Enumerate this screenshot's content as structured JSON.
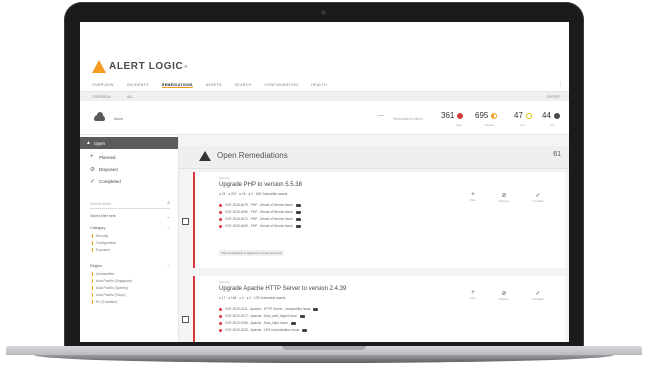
{
  "app": {
    "logo_text": "ALERT LOGIC",
    "logo_reg": "®",
    "nav": [
      "OVERVIEW",
      "INCIDENTS",
      "REMEDIATIONS",
      "ASSETS",
      "SEARCH",
      "CONFIGURATION",
      "HEALTH"
    ],
    "nav_active_index": 2,
    "menu_icon": "⋮",
    "subbar": {
      "crumb1": "OVERVIEW",
      "crumb2": "ALL",
      "right": "EXPORT"
    }
  },
  "stats": {
    "account": "Acme",
    "minus": "—",
    "range": "Remediations filters",
    "high": {
      "value": "361",
      "label": "High",
      "color": "#d63a3a"
    },
    "medium": {
      "value": "695",
      "label": "Medium",
      "color": "#f39c22"
    },
    "low": {
      "value": "47",
      "label": "Low",
      "color": "#d9c300"
    },
    "info": {
      "value": "44",
      "label": "Info",
      "color": "#4a4a4a"
    }
  },
  "sidebar": {
    "open_label": "Open",
    "items": [
      {
        "icon": "+",
        "label": "Planned"
      },
      {
        "icon": "⊘",
        "label": "Disposed"
      },
      {
        "icon": "✓",
        "label": "Completed"
      }
    ],
    "search_placeholder": "Search filters",
    "search_icon": "⌕",
    "sort_label": "Saved filter sets",
    "category": {
      "title": "Category",
      "options": [
        "Security",
        "Configuration",
        "Exposure"
      ]
    },
    "region": {
      "title": "Region",
      "options": [
        "Unclassified",
        "Asia Pacific (Singapore)",
        "Asia Pacific (Sydney)",
        "Asia Pacific (Tokyo)",
        "EU (Frankfurt)"
      ]
    }
  },
  "main": {
    "title": "Open Remediations",
    "count": "61",
    "cards": [
      {
        "tag": "Security",
        "title": "Upgrade PHP to version 5.5.38",
        "meta": "● 24 · ● 207 · ● 16 · ● 0 · 499 Vulnerable assets",
        "lines": [
          "CVE-2016-4070 - PHP - Denial of Service Issue",
          "CVE-2016-4090 - PHP - Denial of Service Issue",
          "CVE-2016-4071 - PHP - Denial of Service Issue",
          "CVE-2016-4600 - PHP - Denial of Service Issue"
        ],
        "note": "This remediation is applied to 2 planned items",
        "actions": [
          {
            "icon": "+",
            "label": "Plan"
          },
          {
            "icon": "⊘",
            "label": "Dispose"
          },
          {
            "icon": "✓",
            "label": "Complete"
          }
        ]
      },
      {
        "tag": "Security",
        "title": "Upgrade Apache HTTP Server to version 2.4.39",
        "meta": "● 17 · ● 148 · ● 4 · ● 0 · 178 Vulnerable assets",
        "lines": [
          "CVE-2019-0211 - Apache - HTTP Server - Unspecified Issue",
          "CVE-2019-0217 - Apache - Mod_auth_digest Issue",
          "CVE-2019-0196 - Apache - Mod_http2 Issue",
          "CVE-2019-0220 - Apache - URL Normalization Issue"
        ],
        "note": "",
        "actions": [
          {
            "icon": "+",
            "label": "Plan"
          },
          {
            "icon": "⊘",
            "label": "Dispose"
          },
          {
            "icon": "✓",
            "label": "Complete"
          }
        ]
      }
    ]
  },
  "colors": {
    "accent": "#f39c22",
    "danger": "#d63a3a",
    "sidebar_open_bg": "#5b5b5b"
  }
}
